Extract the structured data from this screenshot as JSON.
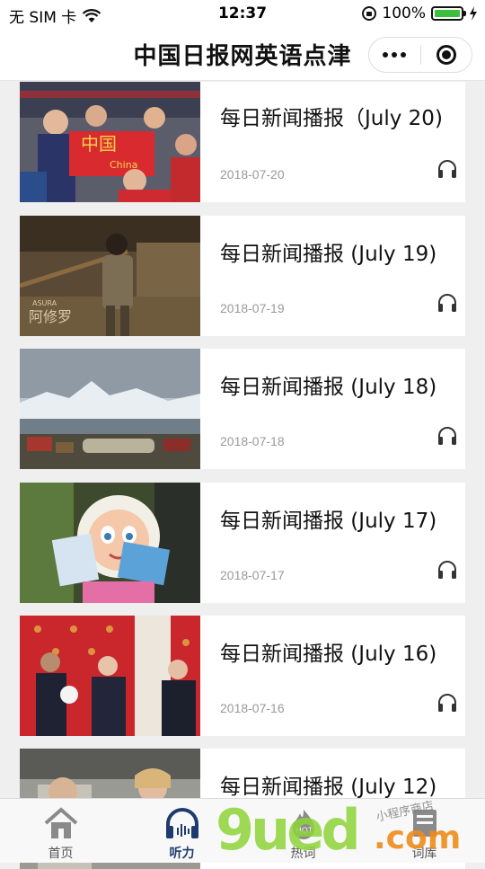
{
  "status_bar": {
    "carrier": "无 SIM 卡",
    "time": "12:37",
    "battery": "100%"
  },
  "navbar": {
    "title": "中国日报网英语点津"
  },
  "items": [
    {
      "title": "每日新闻播报（July 20)",
      "date": "2018-07-20",
      "thumb": "fans-flag"
    },
    {
      "title": "每日新闻播报 (July 19)",
      "date": "2018-07-19",
      "thumb": "movie-still",
      "overlay": "ASURA"
    },
    {
      "title": "每日新闻播报 (July 18)",
      "date": "2018-07-18",
      "thumb": "iceberg"
    },
    {
      "title": "每日新闻播报 (July 17)",
      "date": "2018-07-17",
      "thumb": "mascot"
    },
    {
      "title": "每日新闻播报 (July 16)",
      "date": "2018-07-16",
      "thumb": "leaders"
    },
    {
      "title": "每日新闻播报 (July 12)",
      "date": "",
      "thumb": "car"
    }
  ],
  "tabs": [
    {
      "label": "首页",
      "icon": "home-icon"
    },
    {
      "label": "听力",
      "icon": "headphones-icon",
      "active": true
    },
    {
      "label": "热词",
      "icon": "hot-icon"
    },
    {
      "label": "词库",
      "icon": "book-icon"
    }
  ],
  "watermark": {
    "brand": "9ued",
    "domain": ".com",
    "tagline": "小程序商店"
  },
  "colors": {
    "accent": "#1f3a6e",
    "battery": "#3cbf3c",
    "date_text": "#999999",
    "background": "#efefef"
  }
}
